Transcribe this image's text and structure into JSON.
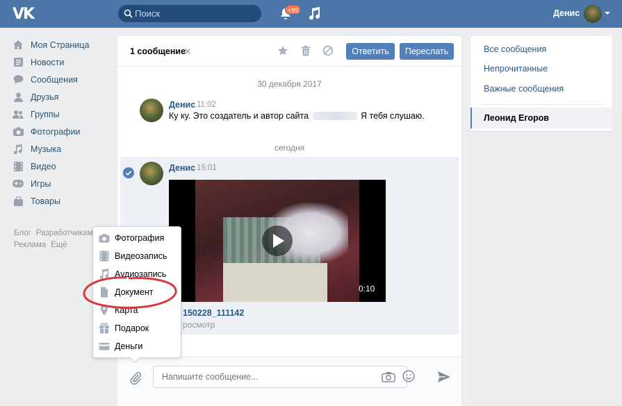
{
  "header": {
    "logo": "VK",
    "search_placeholder": "Поиск",
    "notifications_badge": "+99",
    "user_name": "Денис"
  },
  "sidebar": {
    "items": [
      {
        "label": "Моя Страница",
        "icon": "home-icon"
      },
      {
        "label": "Новости",
        "icon": "news-icon"
      },
      {
        "label": "Сообщения",
        "icon": "messages-icon"
      },
      {
        "label": "Друзья",
        "icon": "friends-icon"
      },
      {
        "label": "Группы",
        "icon": "groups-icon"
      },
      {
        "label": "Фотографии",
        "icon": "camera-icon"
      },
      {
        "label": "Музыка",
        "icon": "music-icon"
      },
      {
        "label": "Видео",
        "icon": "video-icon"
      },
      {
        "label": "Игры",
        "icon": "games-icon"
      },
      {
        "label": "Товары",
        "icon": "bag-icon"
      }
    ],
    "footer": {
      "blog": "Блог",
      "developers": "Разработчикам",
      "ads": "Реклама",
      "more": "Ещё"
    }
  },
  "chat": {
    "selected_count": "1 сообщение",
    "reply_button": "Ответить",
    "forward_button": "Переслать",
    "date_old": "30 декабря 2017",
    "date_today": "сегодня",
    "msg1": {
      "author": "Денис",
      "time": "11:02",
      "text_before": "Ку ку. Это создатель и автор сайта",
      "text_after": "Я тебя слушаю."
    },
    "msg2": {
      "author": "Денис",
      "time": "15:01",
      "video_duration": "0:10",
      "video_title": "150228_111142",
      "video_views": "росмотр"
    },
    "composer_placeholder": "Напишите сообщение..."
  },
  "right_panel": {
    "items": [
      "Все сообщения",
      "Непрочитанные",
      "Важные сообщения"
    ],
    "active_dialog": "Леонид Егоров"
  },
  "attach_menu": {
    "items": [
      {
        "label": "Фотография",
        "icon": "camera-icon"
      },
      {
        "label": "Видеозапись",
        "icon": "film-icon"
      },
      {
        "label": "Аудиозапись",
        "icon": "music-icon"
      },
      {
        "label": "Документ",
        "icon": "document-icon"
      },
      {
        "label": "Карта",
        "icon": "map-pin-icon"
      },
      {
        "label": "Подарок",
        "icon": "gift-icon"
      },
      {
        "label": "Деньги",
        "icon": "card-icon"
      }
    ],
    "highlight_color": "#d8383f"
  },
  "colors": {
    "header": "#4a76a8",
    "accent": "#5181b8",
    "link": "#2a5885",
    "background": "#edeef0"
  }
}
